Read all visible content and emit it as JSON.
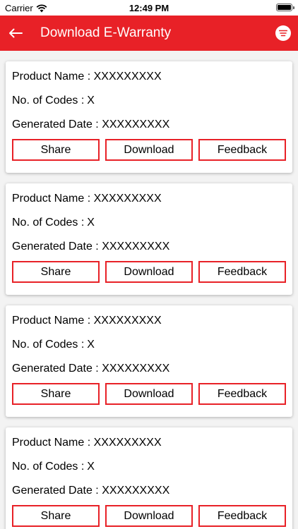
{
  "status_bar": {
    "carrier": "Carrier",
    "time": "12:49 PM"
  },
  "header": {
    "title": "Download E-Warranty"
  },
  "colors": {
    "brand": "#e82127"
  },
  "cards": [
    {
      "product_name": "Product Name : XXXXXXXXX",
      "codes": "No. of Codes :",
      "codes_value": "X",
      "generated_date": "Generated Date : XXXXXXXXX",
      "share": "Share",
      "download": "Download",
      "feedback": "Feedback"
    },
    {
      "product_name": "Product Name : XXXXXXXXX",
      "codes": "No. of Codes :",
      "codes_value": "X",
      "generated_date": "Generated Date : XXXXXXXXX",
      "share": "Share",
      "download": "Download",
      "feedback": "Feedback"
    },
    {
      "product_name": "Product Name : XXXXXXXXX",
      "codes": "No. of Codes :",
      "codes_value": "X",
      "generated_date": "Generated Date : XXXXXXXXX",
      "share": "Share",
      "download": "Download",
      "feedback": "Feedback"
    },
    {
      "product_name": "Product Name : XXXXXXXXX",
      "codes": "No. of Codes :",
      "codes_value": "X",
      "generated_date": "Generated Date : XXXXXXXXX",
      "share": "Share",
      "download": "Download",
      "feedback": "Feedback"
    }
  ]
}
